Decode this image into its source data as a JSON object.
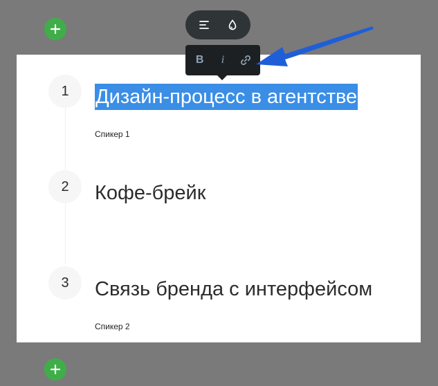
{
  "toolbar": {
    "align_icon": "align-left-icon",
    "color_icon": "droplet-icon"
  },
  "format_bar": {
    "bold_label": "B",
    "italic_label": "i",
    "link_icon": "link-icon"
  },
  "add_icon": "plus-icon",
  "items": [
    {
      "number": "1",
      "title": "Дизайн-процесс в агентстве",
      "speaker": "Спикер 1",
      "selected": true
    },
    {
      "number": "2",
      "title": "Кофе-брейк",
      "speaker": ""
    },
    {
      "number": "3",
      "title": "Связь бренда с интерфейсом",
      "speaker": "Спикер 2"
    }
  ],
  "colors": {
    "accent_add": "#3fae49",
    "selection": "#3a8ee6",
    "arrow": "#1e5fd8"
  }
}
